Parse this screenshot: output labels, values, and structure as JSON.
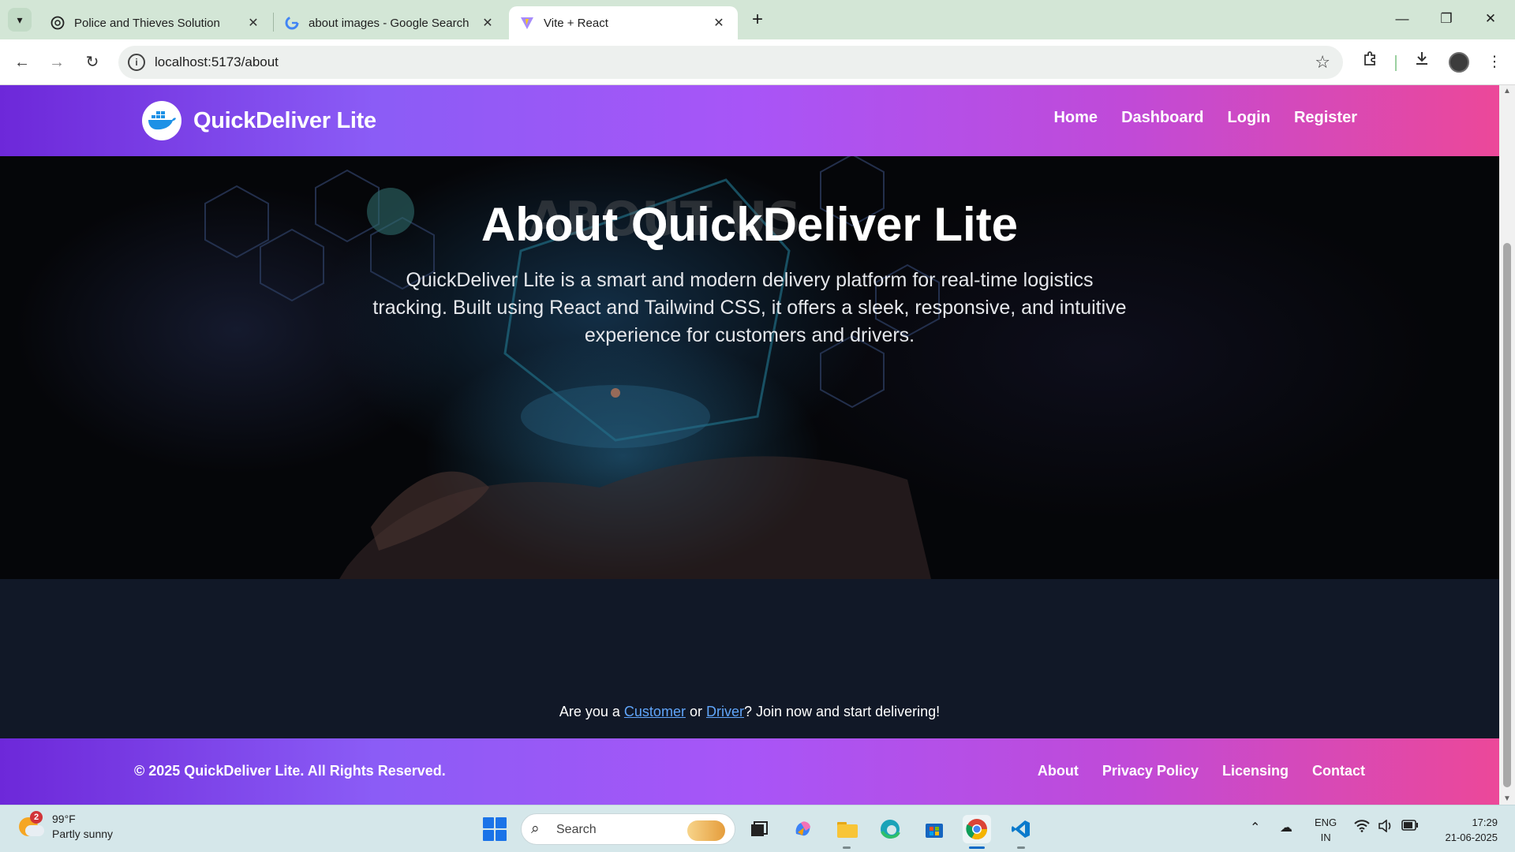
{
  "browser": {
    "tabs": [
      {
        "title": "Police and Thieves Solution",
        "icon": "openai-icon"
      },
      {
        "title": "about images - Google Search",
        "icon": "google-icon"
      },
      {
        "title": "Vite + React",
        "icon": "vite-icon",
        "active": true
      }
    ],
    "url": "localhost:5173/about"
  },
  "site": {
    "brand": "QuickDeliver Lite",
    "nav": [
      "Home",
      "Dashboard",
      "Login",
      "Register"
    ],
    "hero": {
      "title": "About QuickDeliver Lite",
      "text": "QuickDeliver Lite is a smart and modern delivery platform for real-time logistics tracking. Built using React and Tailwind CSS, it offers a sleek, responsive, and intuitive experience for customers and drivers."
    },
    "cta": {
      "prefix": "Are you a ",
      "customer": "Customer",
      "middle": " or ",
      "driver": "Driver",
      "suffix": "? Join now and start delivering!"
    },
    "footer": {
      "copyright": "© 2025 QuickDeliver Lite. All Rights Reserved.",
      "links": [
        "About",
        "Privacy Policy",
        "Licensing",
        "Contact"
      ]
    },
    "colors": {
      "gradient_start": "#6d28d9",
      "gradient_end": "#ec4899",
      "body_bg": "#111827",
      "link": "#60a5fa"
    }
  },
  "taskbar": {
    "weather": {
      "badge": "2",
      "temp": "99°F",
      "desc": "Partly sunny"
    },
    "search_label": "Search",
    "lang": {
      "line1": "ENG",
      "line2": "IN"
    },
    "clock": {
      "time": "17:29",
      "date": "21-06-2025"
    }
  }
}
